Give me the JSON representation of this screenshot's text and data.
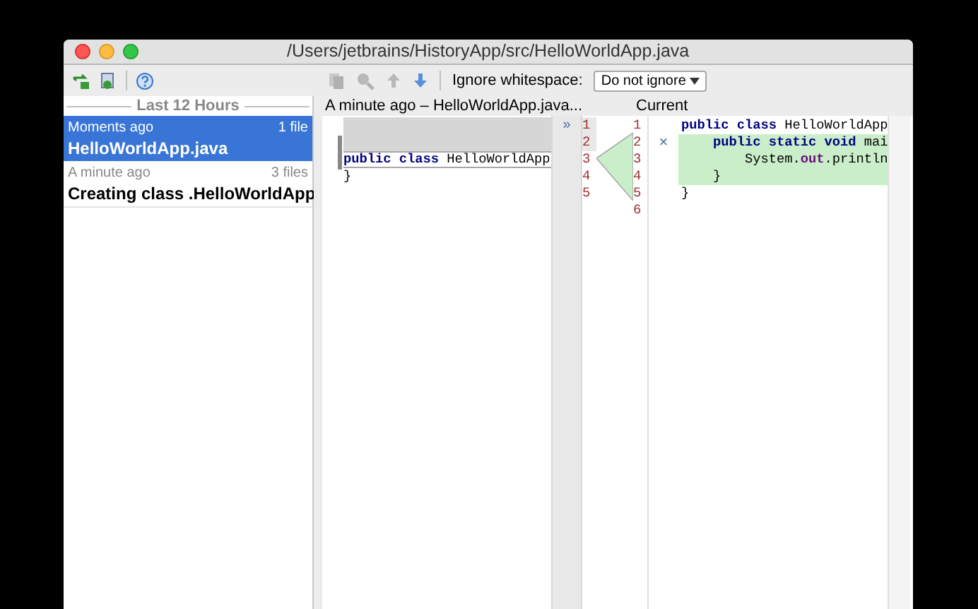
{
  "window": {
    "title": "/Users/jetbrains/HistoryApp/src/HelloWorldApp.java"
  },
  "sidebar": {
    "header": "Last 12 Hours",
    "items": [
      {
        "time": "Moments ago",
        "count": "1 file",
        "title": "HelloWorldApp.java",
        "selected": true
      },
      {
        "time": "A minute ago",
        "count": "3 files",
        "title": "Creating class .HelloWorldApp",
        "selected": false
      }
    ]
  },
  "toolbar": {
    "ignore_label": "Ignore whitespace:",
    "ignore_value": "Do not ignore"
  },
  "left_pane": {
    "title": "A minute ago – HelloWorldApp.java...",
    "marker": "»",
    "lines": [
      {
        "number": "1",
        "kind": "changed"
      },
      {
        "number": "2",
        "kind": "changed"
      },
      {
        "number": "3",
        "kind": "anchor",
        "tokens": [
          {
            "text": "public",
            "kind": "keyword"
          },
          {
            "text": " class",
            "kind": "keyword"
          },
          {
            "text": " HelloWorldApp",
            "kind": "plain"
          }
        ]
      },
      {
        "number": "4",
        "kind": "plain",
        "tokens": [
          {
            "text": "}",
            "kind": "plain"
          }
        ]
      },
      {
        "number": "5",
        "kind": "plain"
      }
    ]
  },
  "right_pane": {
    "title": "Current",
    "lines": [
      {
        "number": "1",
        "kind": "plain",
        "tokens": [
          {
            "text": "public",
            "kind": "keyword"
          },
          {
            "text": " class",
            "kind": "keyword"
          },
          {
            "text": " HelloWorldApp",
            "kind": "plain"
          }
        ]
      },
      {
        "number": "2",
        "kind": "inserted",
        "marker": "×",
        "tokens": [
          {
            "text": "    public",
            "kind": "keyword"
          },
          {
            "text": " static",
            "kind": "keyword"
          },
          {
            "text": " void",
            "kind": "keyword"
          },
          {
            "text": " mai",
            "kind": "plain"
          }
        ]
      },
      {
        "number": "3",
        "kind": "inserted",
        "tokens": [
          {
            "text": "        System.",
            "kind": "plain"
          },
          {
            "text": "out",
            "kind": "field"
          },
          {
            "text": ".println",
            "kind": "plain"
          }
        ]
      },
      {
        "number": "4",
        "kind": "inserted",
        "tokens": [
          {
            "text": "    }",
            "kind": "plain"
          }
        ]
      },
      {
        "number": "5",
        "kind": "plain",
        "tokens": [
          {
            "text": "}",
            "kind": "plain"
          }
        ]
      },
      {
        "number": "6",
        "kind": "plain"
      }
    ]
  }
}
